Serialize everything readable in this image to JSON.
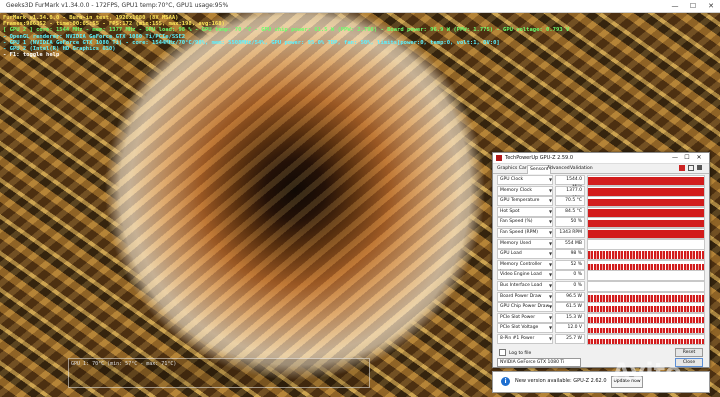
{
  "window": {
    "title": "Geeks3D FurMark v1.34.0.0 - 172FPS, GPU1 temp:70°C, GPU1 usage:95%",
    "minimize": "—",
    "maximize": "☐",
    "close": "✕"
  },
  "hud": {
    "line1": "FurMark v1.34.0.0 - Burn-in test, 1920x1080 (8X MSAA)",
    "line2": "Frames:986352 - time:00:05:55 - FPS:172 (min:155, max:198, avg:168)",
    "line3": "[ GPU 2 ] core: 1544 MHz - mem: 1377 MHz - GPU load: 98 % - GPU temp: 70 °C - GPU chip power: 61.5 W (PPW: 2.796) - Board power: 96.9 W (PPW: 1.775) - GPU voltage: 0.793 V",
    "line4": "- OpenGL renderer: NVIDIA GeForce GTX 1080 Ti/PCIe/SSE2",
    "line5": "- GPU 1 (NVIDIA GeForce GTX 1080 Ti) - core: 1544MHz/70°C/98%, mem: 5508MHz/54%, GPU power: 95.0% TDP, fan: 50%, limits[power:0, temp:0, volt:1, OV:0]",
    "line6": "- GPU 2 (Intel(R) HD Graphics 630)",
    "line7": "- F1: toggle help"
  },
  "temp_graph": {
    "label": "GPU 1: 70°C (min: 57°C - max: 71°C)"
  },
  "gpuz": {
    "title": "TechPowerUp GPU-Z 2.59.0",
    "tabs": [
      "Graphics Card",
      "Sensors",
      "Advanced",
      "Validation"
    ],
    "sensors": [
      {
        "name": "GPU Clock",
        "value": "1544.0 MHz",
        "level": 0.9,
        "noisy": false
      },
      {
        "name": "Memory Clock",
        "value": "1377.0 MHz",
        "level": 0.9,
        "noisy": false
      },
      {
        "name": "GPU Temperature",
        "value": "70.5 °C",
        "level": 0.85,
        "noisy": false
      },
      {
        "name": "Hot Spot",
        "value": "84.5 °C",
        "level": 0.85,
        "noisy": false
      },
      {
        "name": "Fan Speed (%)",
        "value": "50 %",
        "level": 0.85,
        "noisy": false
      },
      {
        "name": "Fan Speed (RPM)",
        "value": "1343 RPM",
        "level": 0.85,
        "noisy": false
      },
      {
        "name": "Memory Used",
        "value": "554 MB",
        "level": 0,
        "noisy": false
      },
      {
        "name": "GPU Load",
        "value": "98 %",
        "level": 0.95,
        "noisy": true
      },
      {
        "name": "Memory Controller Load",
        "value": "52 %",
        "level": 0.6,
        "noisy": true
      },
      {
        "name": "Video Engine Load",
        "value": "0 %",
        "level": 0,
        "noisy": false
      },
      {
        "name": "Bus Interface Load",
        "value": "0 %",
        "level": 0,
        "noisy": false
      },
      {
        "name": "Board Power Draw",
        "value": "96.5 W",
        "level": 0.7,
        "noisy": true
      },
      {
        "name": "GPU Chip Power Draw",
        "value": "61.5 W",
        "level": 0.7,
        "noisy": true
      },
      {
        "name": "PCIe Slot Power",
        "value": "15.3 W",
        "level": 0.6,
        "noisy": true
      },
      {
        "name": "PCIe Slot Voltage",
        "value": "12.0 V",
        "level": 0.6,
        "noisy": true
      },
      {
        "name": "8-Pin #1 Power",
        "value": "25.7 W",
        "level": 0.6,
        "noisy": true
      }
    ],
    "log_label": "Log to file",
    "reset_label": "Reset",
    "gpu_select": "NVIDIA GeForce GTX 1080 Ti",
    "close_label": "Close"
  },
  "notification": {
    "message": "New version available: GPU-Z 2.62.0",
    "button": "Update now"
  },
  "watermark": "Avito",
  "colors": {
    "graph": "#d21c1c",
    "hud_yellow": "#ffe85a",
    "hud_cyan": "#5cf2ff",
    "hud_green": "#6dff6d",
    "hud_white": "#ffffff"
  }
}
